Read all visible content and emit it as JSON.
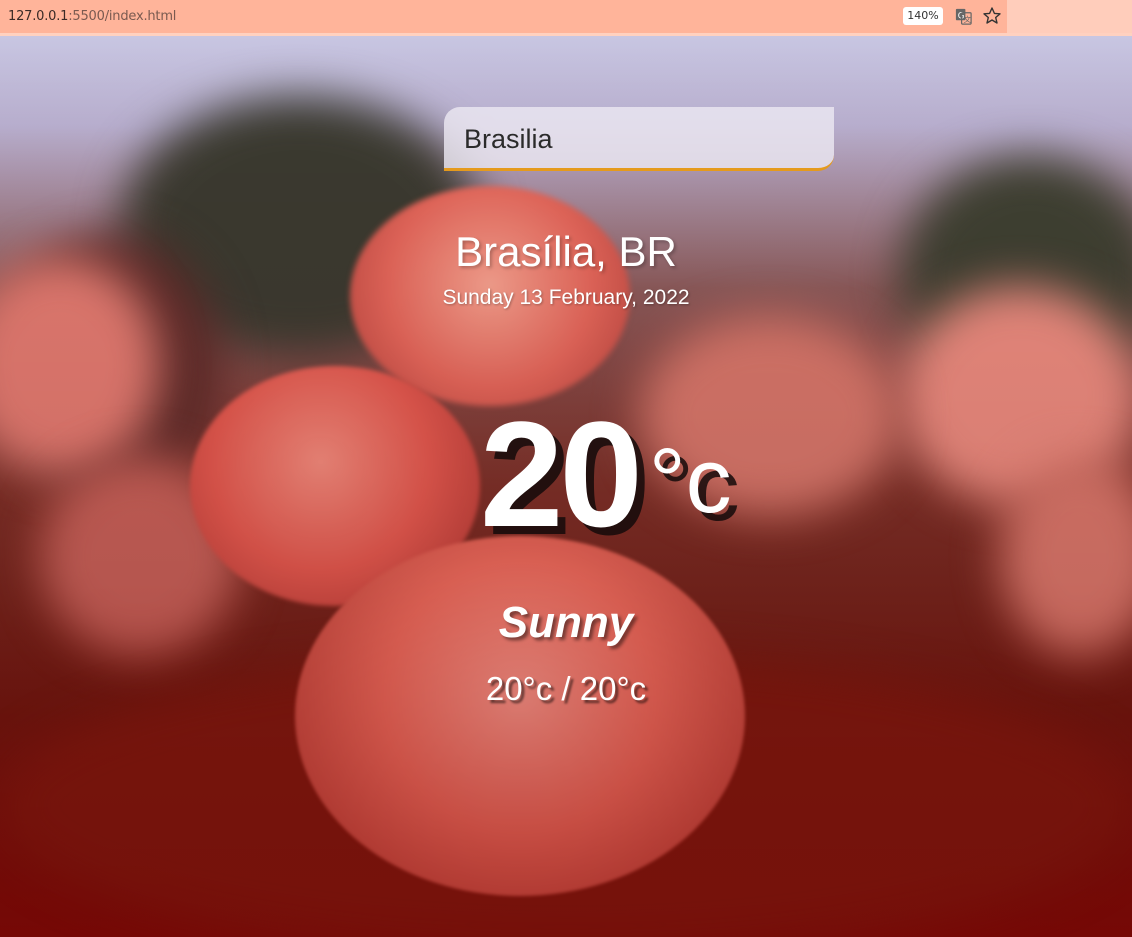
{
  "browser": {
    "url_host": "127.0.0.1",
    "url_path": ":5500/index.html",
    "zoom": "140%",
    "icons": [
      "translate-icon",
      "star-icon"
    ]
  },
  "search": {
    "value": "Brasilia"
  },
  "weather": {
    "location": "Brasília, BR",
    "date": "Sunday 13 February, 2022",
    "temp": "20",
    "unit": "°c",
    "condition": "Sunny",
    "hi_low": "20°c / 20°c"
  },
  "colors": {
    "search_accent": "#e59a1c",
    "browser_bar": "#ffb49a"
  }
}
